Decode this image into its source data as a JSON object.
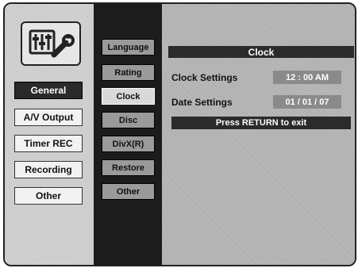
{
  "left_menu": [
    {
      "label": "General"
    },
    {
      "label": "A/V Output"
    },
    {
      "label": "Timer REC"
    },
    {
      "label": "Recording"
    },
    {
      "label": "Other"
    }
  ],
  "mid_menu": [
    {
      "label": "Language"
    },
    {
      "label": "Rating"
    },
    {
      "label": "Clock"
    },
    {
      "label": "Disc"
    },
    {
      "label": "DivX(R)"
    },
    {
      "label": "Restore"
    },
    {
      "label": "Other"
    }
  ],
  "clock_panel": {
    "title": "Clock",
    "clock_label": "Clock Settings",
    "clock_value": "12 : 00 AM",
    "date_label": "Date Settings",
    "date_value": "01 / 01 / 07",
    "exit_hint": "Press RETURN to exit"
  },
  "icons": {
    "setup": "equalizer-wrench-icon"
  },
  "colors": {
    "active_left": "#2a2a2a",
    "active_mid": "#d9d9d9",
    "panel_dark": "#2b2b2b"
  }
}
